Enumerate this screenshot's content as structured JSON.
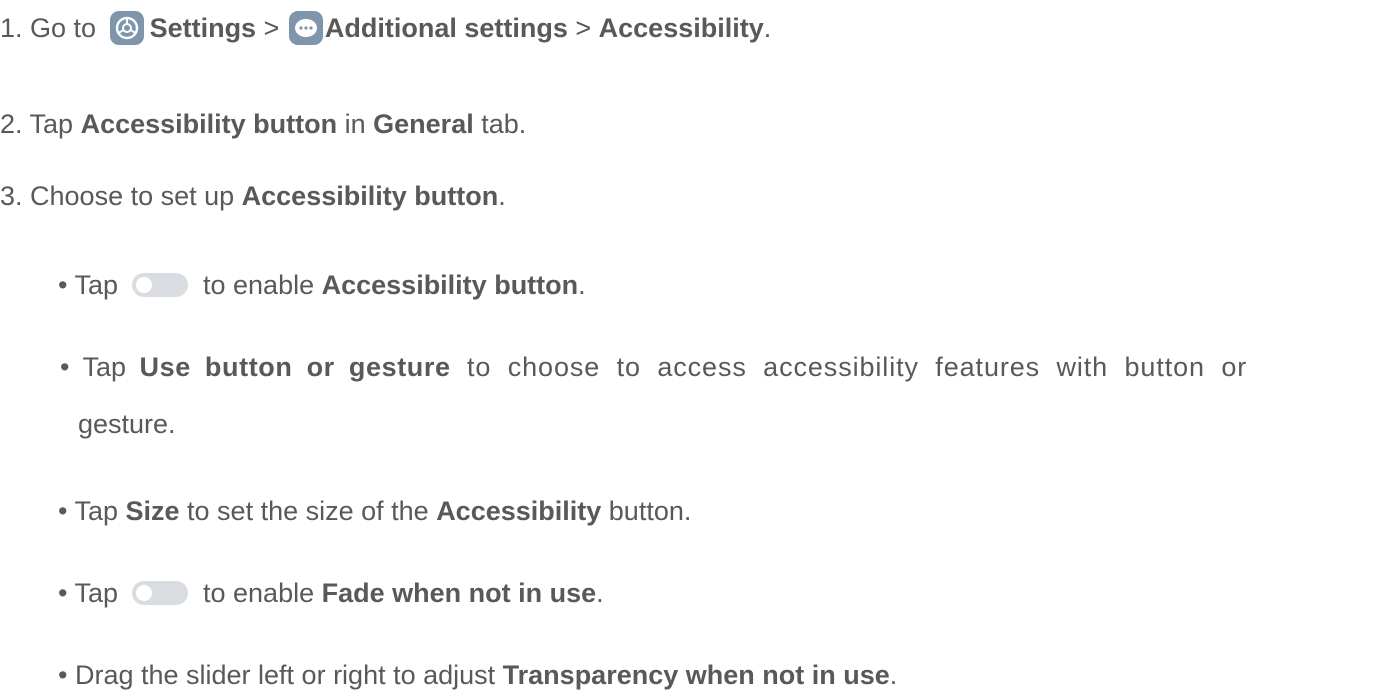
{
  "step1": {
    "prefix": "1. Go to ",
    "settings": "Settings",
    "sep1": " > ",
    "additional": "Additional settings",
    "sep2": " > ",
    "accessibility": "Accessibility",
    "end": "."
  },
  "step2": {
    "prefix": "2. Tap ",
    "bold1": "Accessibility button",
    "mid": " in ",
    "bold2": "General",
    "end": " tab."
  },
  "step3": {
    "prefix": "3. Choose to set up ",
    "bold": "Accessibility button",
    "end": "."
  },
  "bullets": {
    "b1": {
      "prefix": "• Tap ",
      "mid": " to enable ",
      "bold": "Accessibility button",
      "end": "."
    },
    "b2": {
      "prefix": "• Tap ",
      "bold": "Use button or gesture",
      "line1_end": " to choose to access accessibility features with button or",
      "line2": "gesture."
    },
    "b3": {
      "prefix": "• Tap ",
      "bold1": "Size",
      "mid": " to set the size of the ",
      "bold2": "Accessibility",
      "end": " button."
    },
    "b4": {
      "prefix": "• Tap ",
      "mid": " to enable ",
      "bold": "Fade when not in use",
      "end": "."
    },
    "b5": {
      "prefix": "• Drag the slider left or right to adjust ",
      "bold": "Transparency when not in use",
      "end": "."
    }
  },
  "icons": {
    "settings": "settings-gear-icon",
    "additional": "more-dots-icon",
    "toggle": "toggle-off-icon"
  },
  "colors": {
    "text": "#595959",
    "icon_bg": "#7e95ab",
    "toggle_track": "#d9dde2"
  }
}
